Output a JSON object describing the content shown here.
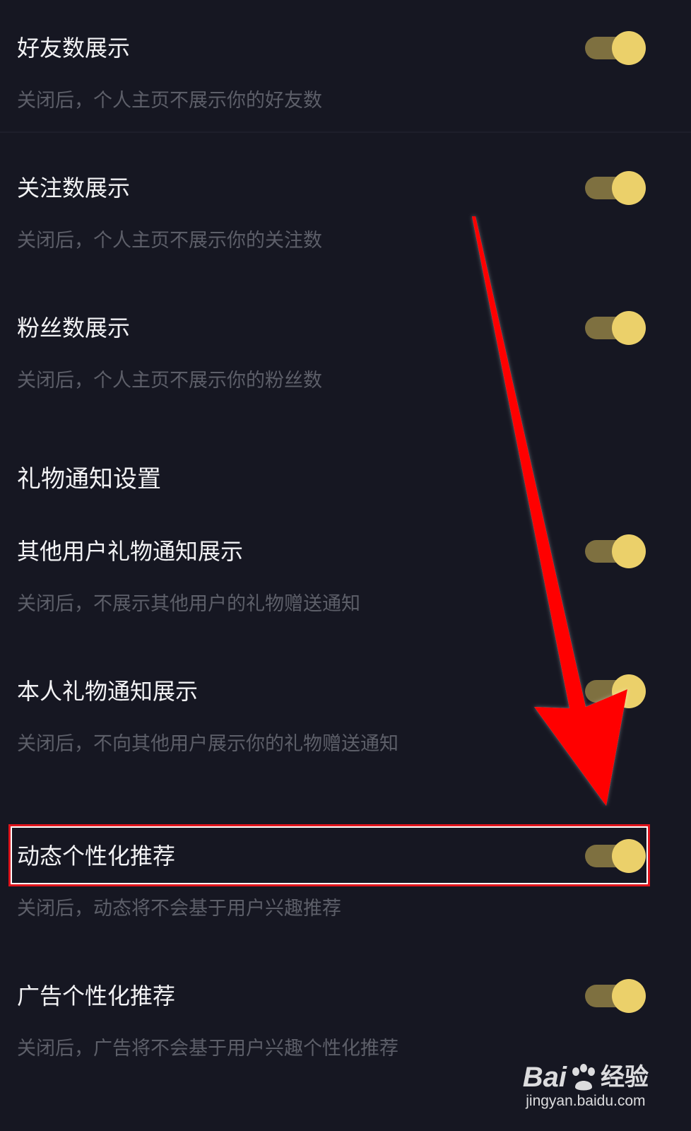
{
  "settings": {
    "friends": {
      "title": "好友数展示",
      "desc": "关闭后，个人主页不展示你的好友数"
    },
    "following": {
      "title": "关注数展示",
      "desc": "关闭后，个人主页不展示你的关注数"
    },
    "fans": {
      "title": "粉丝数展示",
      "desc": "关闭后，个人主页不展示你的粉丝数"
    },
    "gift_section": {
      "header": "礼物通知设置"
    },
    "other_gift": {
      "title": "其他用户礼物通知展示",
      "desc": "关闭后，不展示其他用户的礼物赠送通知"
    },
    "own_gift": {
      "title": "本人礼物通知展示",
      "desc": "关闭后，不向其他用户展示你的礼物赠送通知"
    },
    "feed_personalization": {
      "title": "动态个性化推荐",
      "desc": "关闭后，动态将不会基于用户兴趣推荐"
    },
    "ad_personalization": {
      "title": "广告个性化推荐",
      "desc": "关闭后，广告将不会基于用户兴趣个性化推荐"
    }
  },
  "toggle_states": {
    "friends": "on",
    "following": "on",
    "fans": "on",
    "other_gift": "on",
    "own_gift": "on",
    "feed_personalization": "on",
    "ad_personalization": "on"
  },
  "colors": {
    "background": "#161722",
    "title_text": "#f2f2f4",
    "desc_text": "#5d5f69",
    "toggle_track": "#7e7040",
    "toggle_knob": "#ebd06a",
    "highlight": "#e0141c",
    "arrow": "#ff0000"
  },
  "watermark": {
    "brand": "Bai",
    "brand_suffix": "经验",
    "url": "jingyan.baidu.com"
  }
}
